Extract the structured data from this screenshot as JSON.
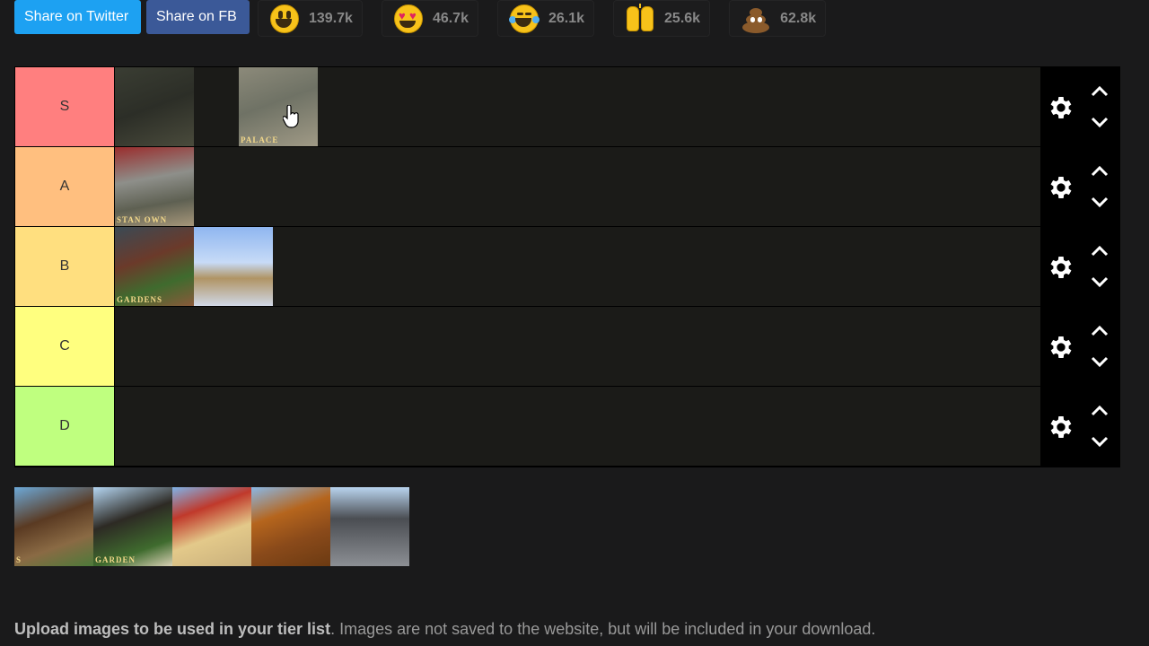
{
  "share": {
    "twitter_label": "Share on Twitter",
    "fb_label": "Share on FB"
  },
  "reactions": [
    {
      "icon": "grinning-face-icon",
      "count": "139.7k"
    },
    {
      "icon": "heart-eyes-icon",
      "count": "46.7k"
    },
    {
      "icon": "tears-of-joy-icon",
      "count": "26.1k"
    },
    {
      "icon": "raising-hands-icon",
      "count": "25.6k"
    },
    {
      "icon": "pile-of-poo-icon",
      "count": "62.8k"
    }
  ],
  "tiers": [
    {
      "label": "S",
      "color": "#ff7f7f",
      "items": [
        {
          "caption": "",
          "gradient": "linear-gradient(160deg,#3a3d33,#2c2e27 50%,#4a4b3c)"
        },
        {
          "caption": "PALACE",
          "gradient": "linear-gradient(160deg,#8c8a7a,#6f7265 45%,#a09a86)"
        }
      ]
    },
    {
      "label": "A",
      "color": "#ffbf7f",
      "items": [
        {
          "caption": "STAN OWN",
          "gradient": "linear-gradient(170deg,#9a2d2d 0%,#8e8f8a 40%,#5e6052 70%,#a7977a)"
        }
      ]
    },
    {
      "label": "B",
      "color": "#ffdf7f",
      "items": [
        {
          "caption": "GARDENS",
          "gradient": "linear-gradient(160deg,#3a4a55,#6b3a2a 40%,#3f6b2e 70%,#8a5a3a)"
        },
        {
          "caption": "",
          "gradient": "linear-gradient(180deg,#8fb6f0,#c7dbf7 45%,#b09464 65%,#d0d8e6)"
        }
      ]
    },
    {
      "label": "C",
      "color": "#ffff7f",
      "items": []
    },
    {
      "label": "D",
      "color": "#bfff7f",
      "items": []
    }
  ],
  "pool": [
    {
      "caption": "S",
      "gradient": "linear-gradient(160deg,#6da9d8,#5a3a22 40%,#8a6a44 70%,#4d7a3a)"
    },
    {
      "caption": "GARDEN",
      "gradient": "linear-gradient(160deg,#b5d6f2,#2d2a24 40%,#3f6b2e 75%,#d8d0b4)"
    },
    {
      "caption": "",
      "gradient": "linear-gradient(160deg,#7fb3e8,#c0392b 30%,#e3c98a 60%,#c9b07c)"
    },
    {
      "caption": "",
      "gradient": "linear-gradient(160deg,#8ab8e6,#b5651d 35%,#8a4a1a 65%,#6b3a12)"
    },
    {
      "caption": "",
      "gradient": "linear-gradient(180deg,#b9d4ef,#4a4d52 40%,#6b6e73 70%,#8c8f94)"
    }
  ],
  "info": {
    "bold": "Upload images to be used in your tier list",
    "rest": ". Images are not saved to the website, but will be included in your download."
  }
}
